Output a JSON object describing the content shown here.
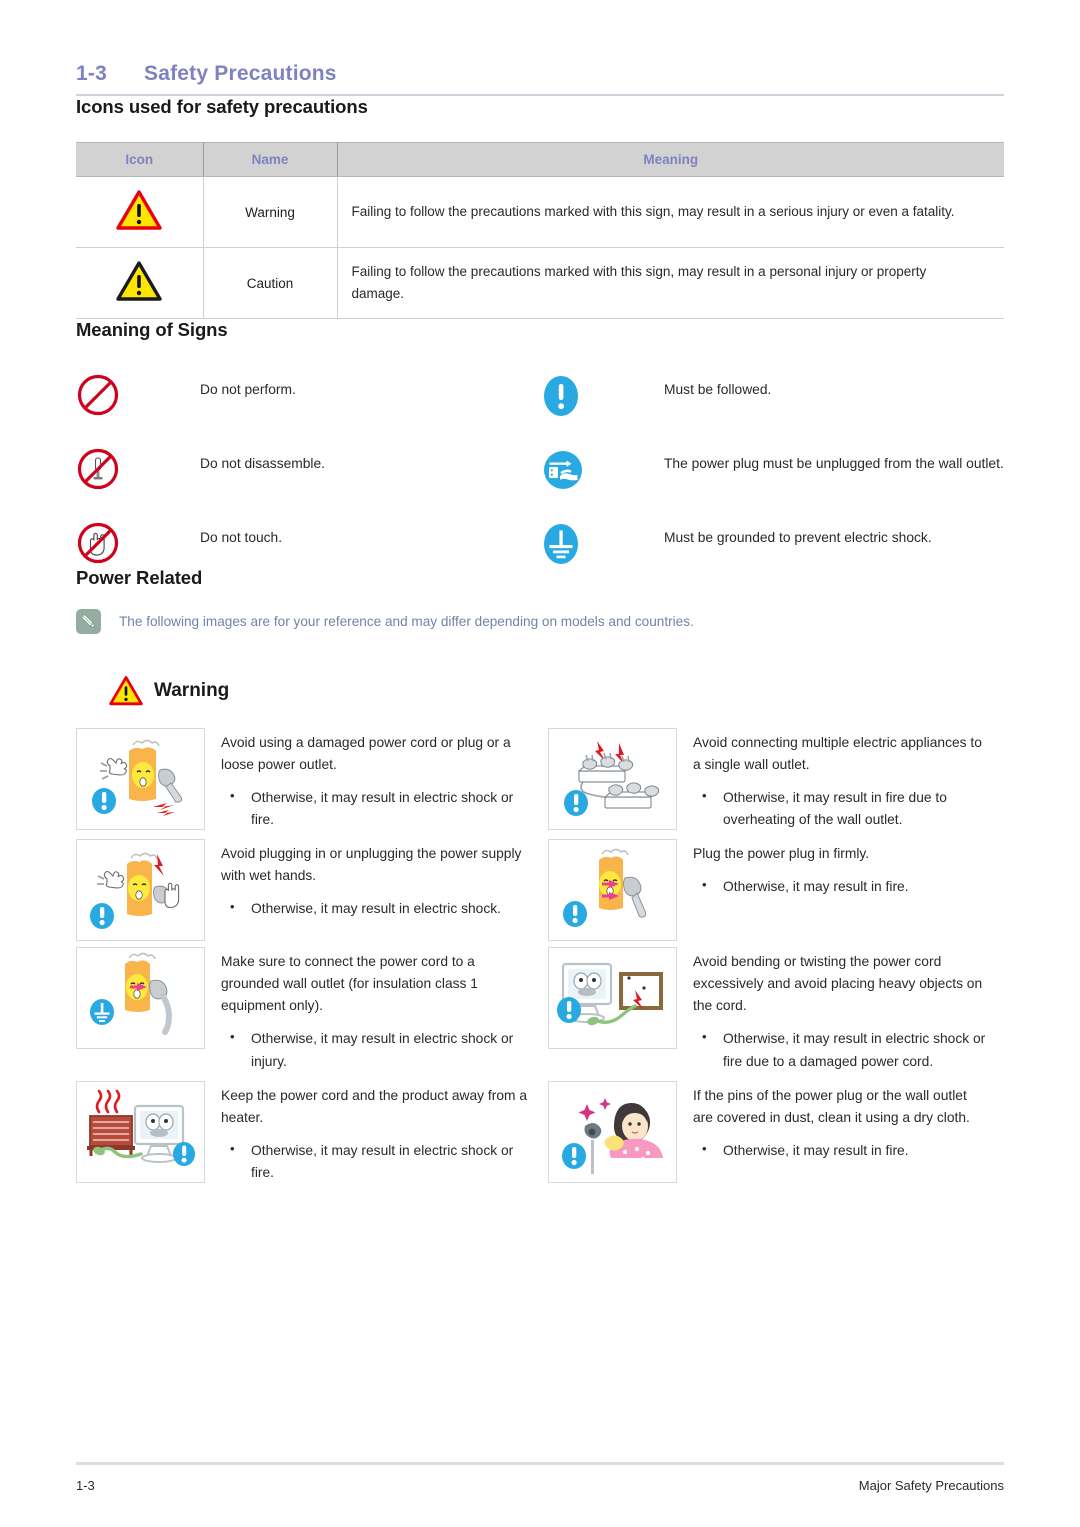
{
  "header": {
    "number": "1-3",
    "title": "Safety Precautions"
  },
  "sections": {
    "icons_used": "Icons used for safety precautions",
    "meaning_of_signs": "Meaning of Signs",
    "power_related": "Power Related"
  },
  "icon_table": {
    "columns": [
      "Icon",
      "Name",
      "Meaning"
    ],
    "rows": [
      {
        "icon": "warning-triangle-red-icon",
        "name": "Warning",
        "meaning": "Failing to follow the precautions marked with this sign, may result in a serious injury or even a fatality."
      },
      {
        "icon": "caution-triangle-black-icon",
        "name": "Caution",
        "meaning": "Failing to follow the precautions marked with this sign, may result in a personal injury or property damage."
      }
    ]
  },
  "signs": [
    {
      "icon": "prohibition-circle-icon",
      "text": "Do not perform."
    },
    {
      "icon": "mandatory-exclamation-icon",
      "text": "Must be followed."
    },
    {
      "icon": "no-disassemble-icon",
      "text": "Do not disassemble."
    },
    {
      "icon": "unplug-power-icon",
      "text": "The power plug must be unplugged from the wall outlet."
    },
    {
      "icon": "no-touch-hand-icon",
      "text": "Do not touch."
    },
    {
      "icon": "grounding-icon",
      "text": "Must be grounded to prevent electric shock."
    }
  ],
  "note": {
    "icon": "pencil-note-icon",
    "text": "The following images are for your reference and may differ depending on models and countries."
  },
  "warning_banner": {
    "icon": "warning-triangle-red-icon",
    "label": "Warning"
  },
  "warning_items": [
    {
      "illustration": "damaged-plug-outlet-illustration",
      "badge": "mandatory-exclamation-icon",
      "title": "Avoid using a damaged power cord or plug or a loose power outlet.",
      "bullets": [
        "Otherwise, it may result in electric shock or fire."
      ]
    },
    {
      "illustration": "multiple-appliances-powerstrip-illustration",
      "badge": "mandatory-exclamation-icon",
      "title": "Avoid connecting multiple electric appliances to a single wall outlet.",
      "bullets": [
        "Otherwise, it may result in fire due to overheating of the wall outlet."
      ]
    },
    {
      "illustration": "wet-hands-plug-illustration",
      "badge": "mandatory-exclamation-icon",
      "title": "Avoid plugging in or unplugging the power supply with wet hands.",
      "bullets": [
        "Otherwise, it may result in electric shock."
      ]
    },
    {
      "illustration": "plug-firmly-illustration",
      "badge": "mandatory-exclamation-icon",
      "title": "Plug the power plug in firmly.",
      "bullets": [
        "Otherwise, it may result in fire."
      ]
    },
    {
      "illustration": "grounded-outlet-illustration",
      "badge": "grounding-icon",
      "title": "Make sure to connect the power cord to a grounded wall outlet (for insulation class 1 equipment only).",
      "bullets": [
        "Otherwise, it may result in electric shock or injury."
      ]
    },
    {
      "illustration": "bent-cord-heavy-object-illustration",
      "badge": "mandatory-exclamation-icon",
      "title": "Avoid bending or twisting the power cord excessively and avoid placing heavy objects on the cord.",
      "bullets": [
        "Otherwise, it may result in electric shock or fire due to a damaged power cord."
      ]
    },
    {
      "illustration": "heater-near-monitor-illustration",
      "badge": "mandatory-exclamation-icon",
      "title": "Keep the power cord and the product away from a heater.",
      "bullets": [
        "Otherwise, it may result in electric shock or fire."
      ]
    },
    {
      "illustration": "dusty-plug-cleaning-illustration",
      "badge": "mandatory-exclamation-icon",
      "title": "If the pins of the power plug or the wall outlet are covered in dust, clean it using a dry cloth.",
      "bullets": [
        "Otherwise, it may result in fire."
      ]
    }
  ],
  "footer": {
    "page_number": "1-3",
    "section_name": "Major Safety Precautions"
  },
  "colors": {
    "heading_purple": "#7f82c0",
    "table_header_bg": "#d2d2d2",
    "note_text_blue": "#6f84a8",
    "note_icon_bg": "#93ada2",
    "mandatory_blue": "#29a9e1",
    "prohibition_red": "#d0021b",
    "warning_yellow": "#ffe600",
    "warning_red_border": "#e8000d"
  }
}
